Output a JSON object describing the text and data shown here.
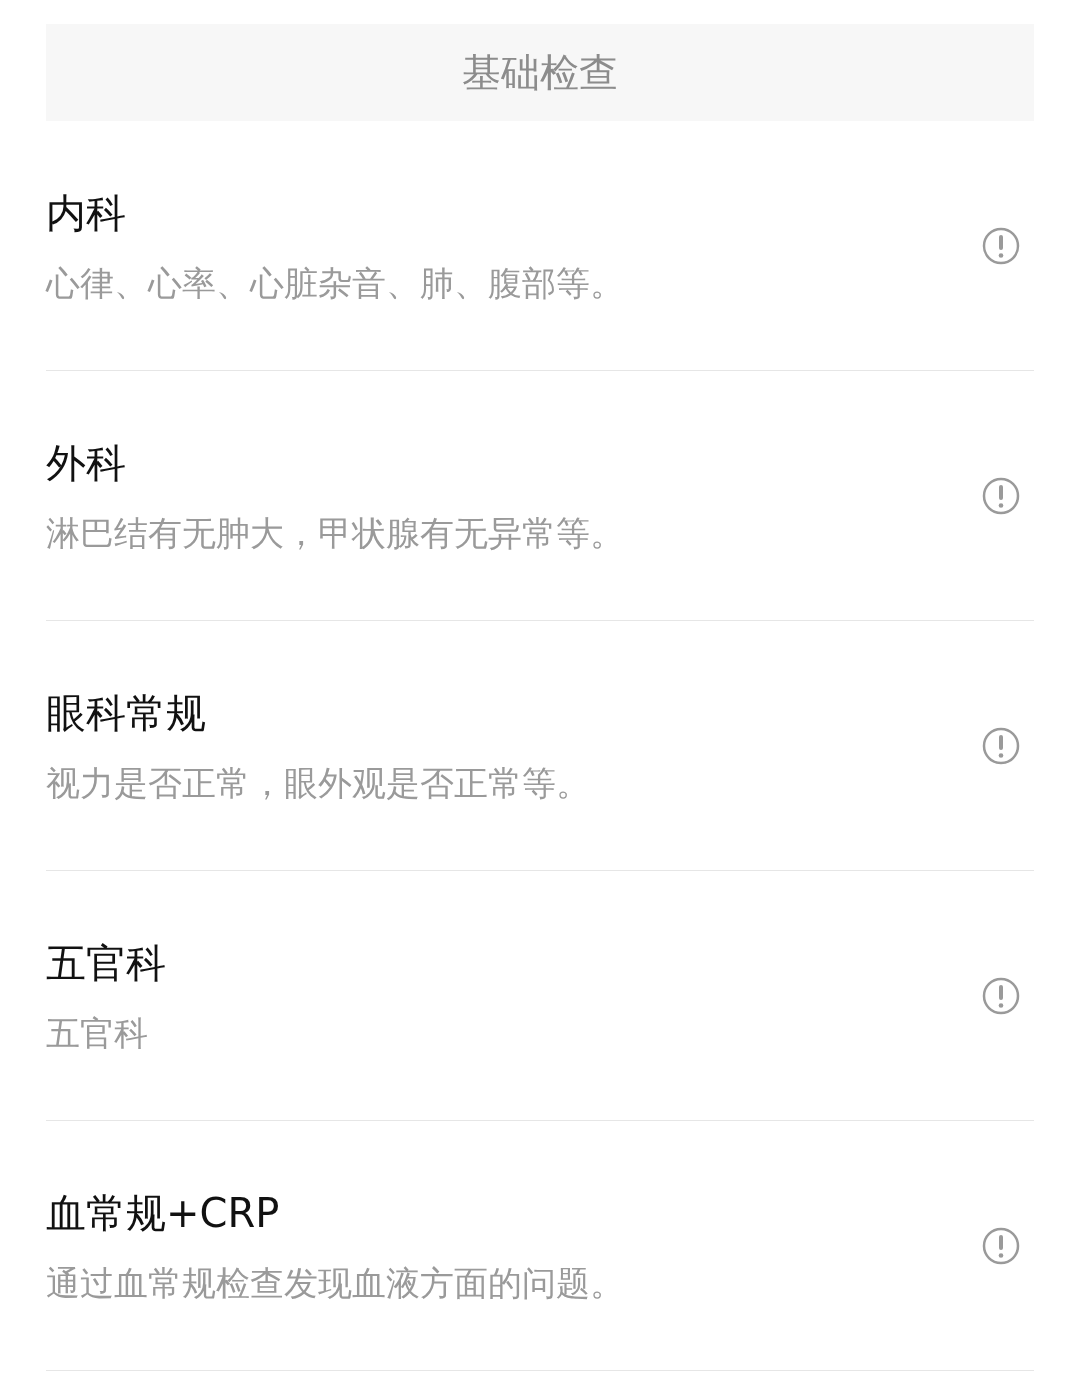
{
  "header": {
    "title": "基础检查"
  },
  "items": [
    {
      "title": "内科",
      "description": "心律、心率、心脏杂音、肺、腹部等。"
    },
    {
      "title": "外科",
      "description": "淋巴结有无肿大，甲状腺有无异常等。"
    },
    {
      "title": "眼科常规",
      "description": "视力是否正常，眼外观是否正常等。"
    },
    {
      "title": "五官科",
      "description": "五官科"
    },
    {
      "title": "血常规+CRP",
      "description": "通过血常规检查发现血液方面的问题。"
    }
  ]
}
